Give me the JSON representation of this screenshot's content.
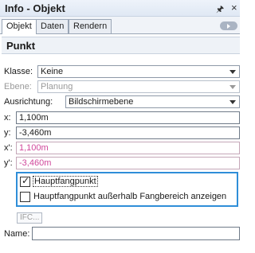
{
  "panel": {
    "title": "Info - Objekt",
    "pin_icon": "pin-icon",
    "close_glyph": "×"
  },
  "tabs": [
    {
      "label": "Objekt",
      "active": true
    },
    {
      "label": "Daten",
      "active": false
    },
    {
      "label": "Rendern",
      "active": false
    }
  ],
  "section": {
    "title": "Punkt"
  },
  "fields": {
    "klasse": {
      "label": "Klasse:",
      "value": "Keine"
    },
    "ebene": {
      "label": "Ebene:",
      "value": "Planung"
    },
    "ausrichtung": {
      "label": "Ausrichtung:",
      "value": "Bildschirmebene"
    },
    "x": {
      "label": "x:",
      "value": "1,100m"
    },
    "y": {
      "label": "y:",
      "value": "-3,460m"
    },
    "x_prime": {
      "label": "x':",
      "value": "1,100m"
    },
    "y_prime": {
      "label": "y':",
      "value": "-3,460m"
    }
  },
  "checkboxes": {
    "hauptfangpunkt": {
      "label": "Hauptfangpunkt",
      "checked": true
    },
    "ausserhalb": {
      "label": "Hauptfangpunkt außerhalb Fangbereich anzeigen",
      "checked": false
    }
  },
  "ifc": {
    "label": "IFC..."
  },
  "name": {
    "label": "Name:",
    "value": ""
  },
  "colors": {
    "highlight": "#2f8ed8",
    "disabled_value": "#d0479b"
  }
}
